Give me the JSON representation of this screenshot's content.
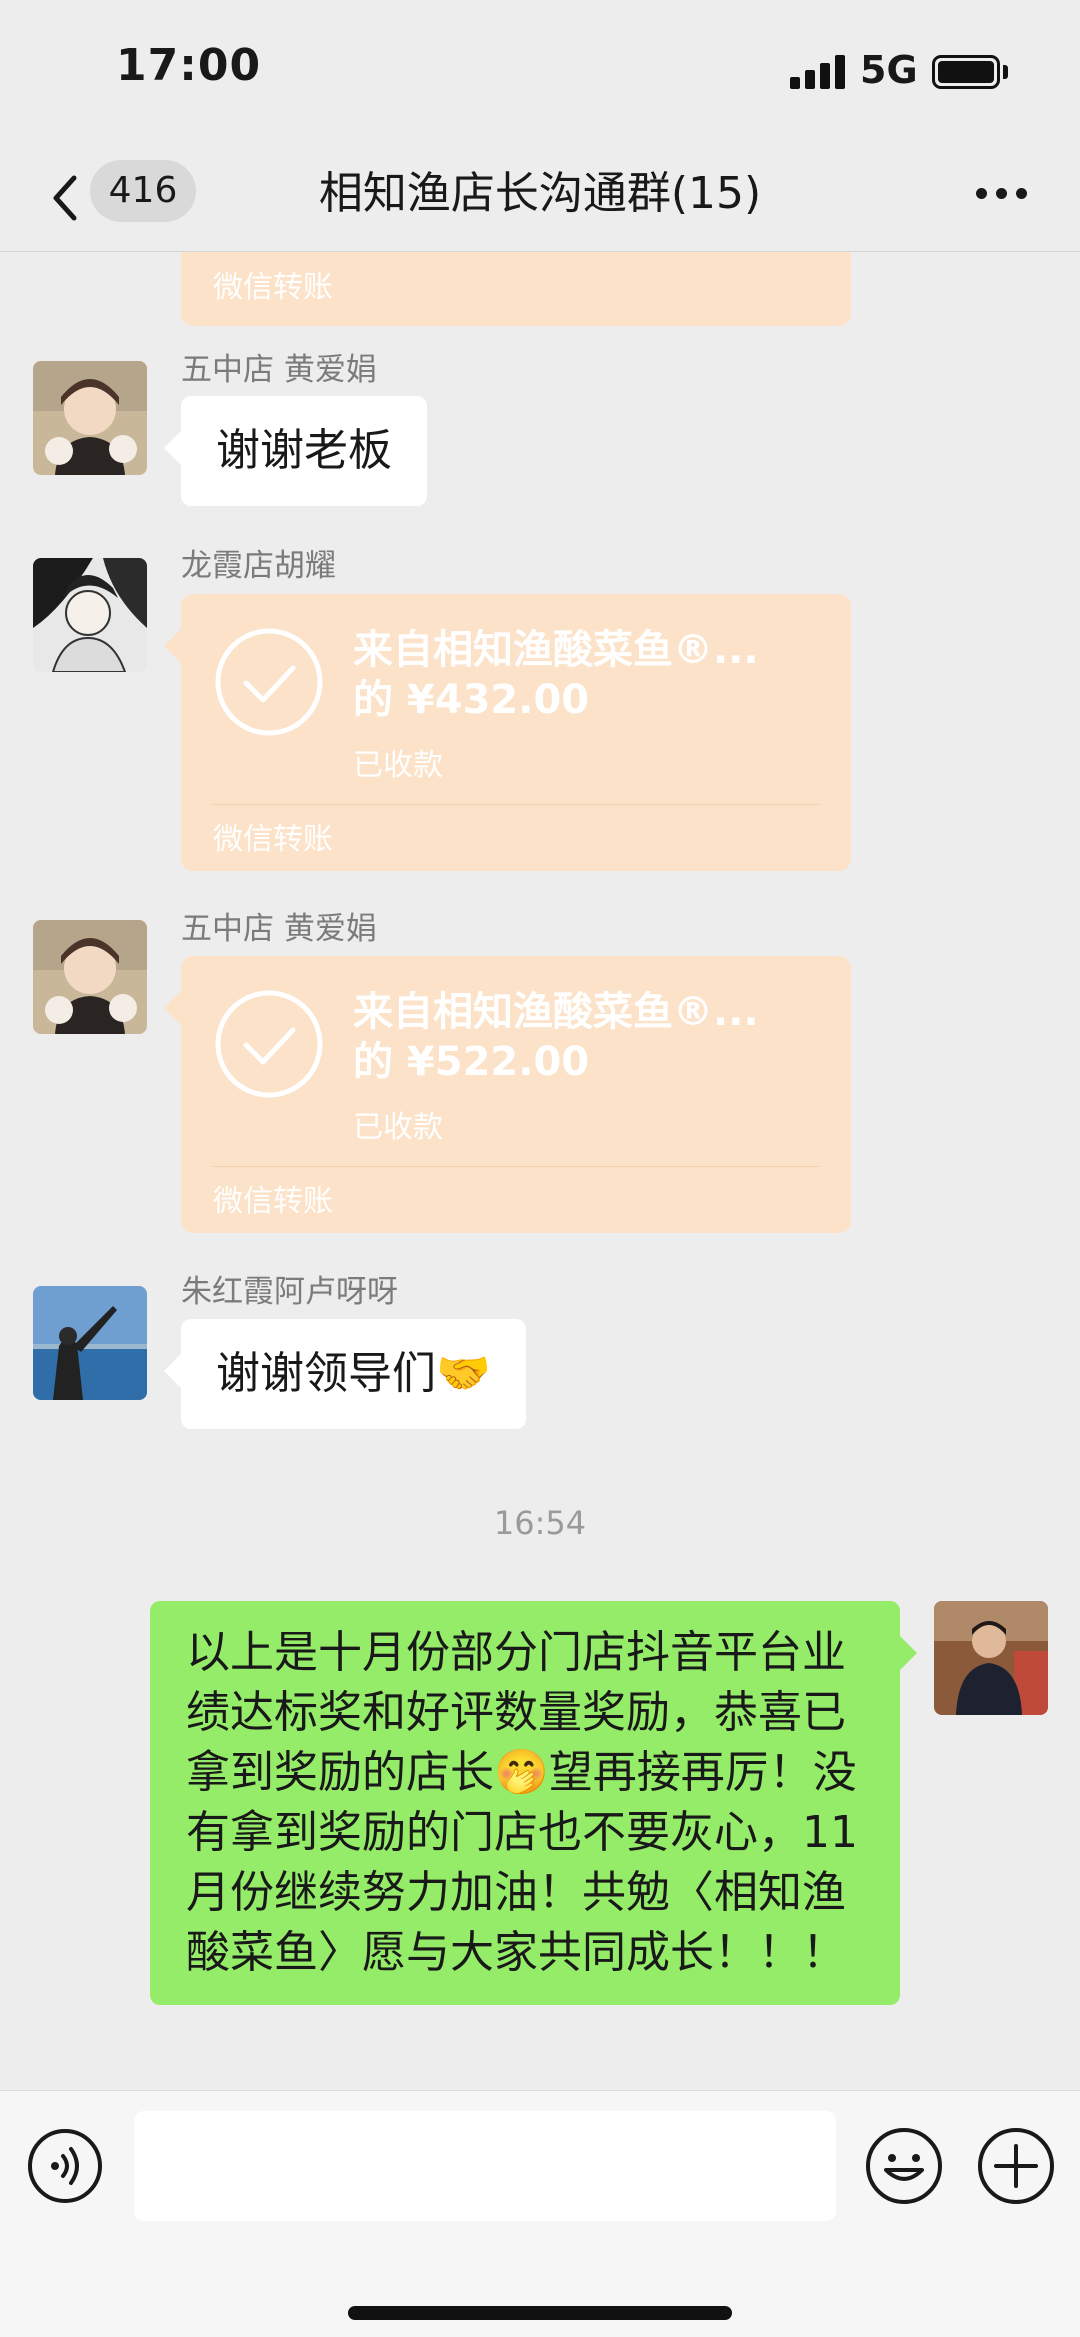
{
  "status_bar": {
    "time": "17:00",
    "network": "5G"
  },
  "nav": {
    "unread_count": "416",
    "title": "相知渔店长沟通群(15)"
  },
  "messages": [
    {
      "type": "transfer_partial",
      "footer": "微信转账"
    },
    {
      "type": "text",
      "sender": "五中店 黄爱娟",
      "text": "谢谢老板"
    },
    {
      "type": "transfer",
      "sender": "龙霞店胡耀",
      "title_line1": "来自相知渔酸菜鱼®...",
      "title_line2": "的 ¥432.00",
      "status": "已收款",
      "footer": "微信转账"
    },
    {
      "type": "transfer",
      "sender": "五中店 黄爱娟",
      "title_line1": "来自相知渔酸菜鱼®...",
      "title_line2": "的 ¥522.00",
      "status": "已收款",
      "footer": "微信转账"
    },
    {
      "type": "text",
      "sender": "朱红霞阿卢呀呀",
      "text": "谢谢领导们🤝"
    },
    {
      "type": "time",
      "text": "16:54"
    },
    {
      "type": "self_text",
      "text": "以上是十月份部分门店抖音平台业绩达标奖和好评数量奖励，恭喜已拿到奖励的店长🤭望再接再厉！没有拿到奖励的门店也不要灰心，11月份继续努力加油！共勉〈相知渔酸菜鱼〉愿与大家共同成长！！！"
    }
  ],
  "input_bar": {
    "value": "",
    "placeholder": ""
  },
  "icons": {
    "back": "chevron-left-icon",
    "more": "more-dots-icon",
    "voice": "voice-icon",
    "emoji": "emoji-icon",
    "plus": "plus-icon",
    "check": "check-circle-icon"
  },
  "colors": {
    "background": "#ededed",
    "transfer": "#fbe2c8",
    "self_bubble": "#95ec69",
    "other_bubble": "#ffffff"
  }
}
